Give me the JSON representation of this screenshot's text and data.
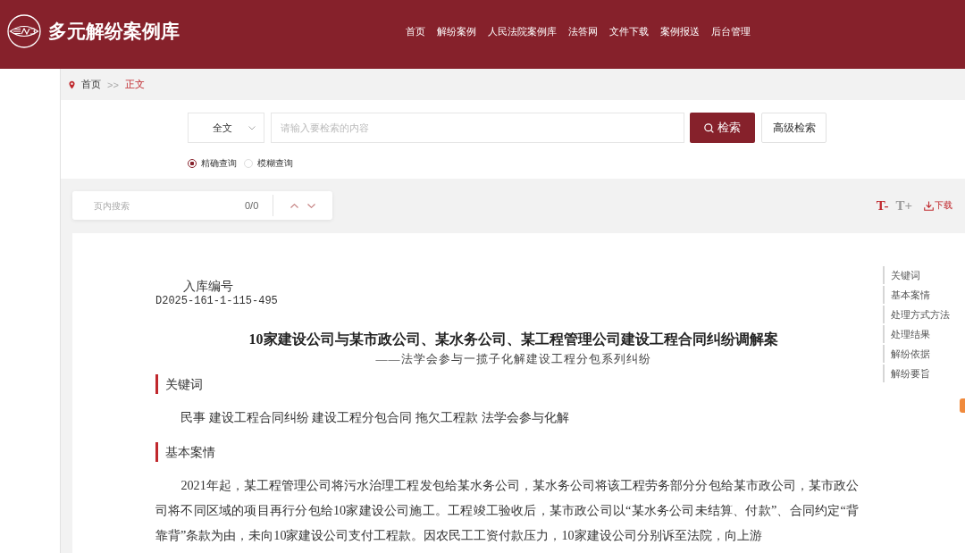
{
  "header": {
    "site_title": "多元解纷案例库",
    "nav": [
      {
        "label": "首页"
      },
      {
        "label": "解纷案例"
      },
      {
        "label": "人民法院案例库"
      },
      {
        "label": "法答网"
      },
      {
        "label": "文件下载"
      },
      {
        "label": "案例报送"
      },
      {
        "label": "后台管理"
      }
    ]
  },
  "breadcrumb": {
    "separator": ">>",
    "items": [
      {
        "label": "首页",
        "current": false
      },
      {
        "label": "正文",
        "current": true
      }
    ]
  },
  "search": {
    "scope": "全文",
    "placeholder": "请输入要检索的内容",
    "search_button": "检索",
    "advanced_button": "高级检索",
    "modes": [
      {
        "label": "精确查询",
        "selected": true
      },
      {
        "label": "模糊查询",
        "selected": false
      }
    ]
  },
  "toolbar": {
    "find": {
      "placeholder": "页内搜索",
      "count": "0/0"
    },
    "font_buttons": [
      {
        "label": "T-",
        "active": true
      },
      {
        "label": "T+",
        "active": false
      }
    ],
    "download": "下载"
  },
  "document": {
    "id_label": "入库编号",
    "id": "D2025-161-1-115-495",
    "title": "10家建设公司与某市政公司、某水务公司、某工程管理公司建设工程合同纠纷调解案",
    "subtitle": "——法学会参与一揽子化解建设工程分包系列纠纷",
    "sections": [
      {
        "heading": "关键词",
        "text": "民事 建设工程合同纠纷 建设工程分包合同 拖欠工程款 法学会参与化解"
      },
      {
        "heading": "基本案情",
        "text": "2021年起，某工程管理公司将污水治理工程发包给某水务公司，某水务公司将该工程劳务部分分包给某市政公司，某市政公司将不同区域的项目再行分包给10家建设公司施工。工程竣工验收后，某市政公司以“某水务公司未结算、付款”、合同约定“背靠背”条款为由，未向10家建设公司支付工程款。因农民工工资付款压力，10家建设公司分别诉至法院，向上游"
      }
    ],
    "toc": [
      {
        "label": "关键词"
      },
      {
        "label": "基本案情"
      },
      {
        "label": "处理方式方法"
      },
      {
        "label": "处理结果"
      },
      {
        "label": "解纷依据"
      },
      {
        "label": "解纷要旨"
      }
    ]
  }
}
